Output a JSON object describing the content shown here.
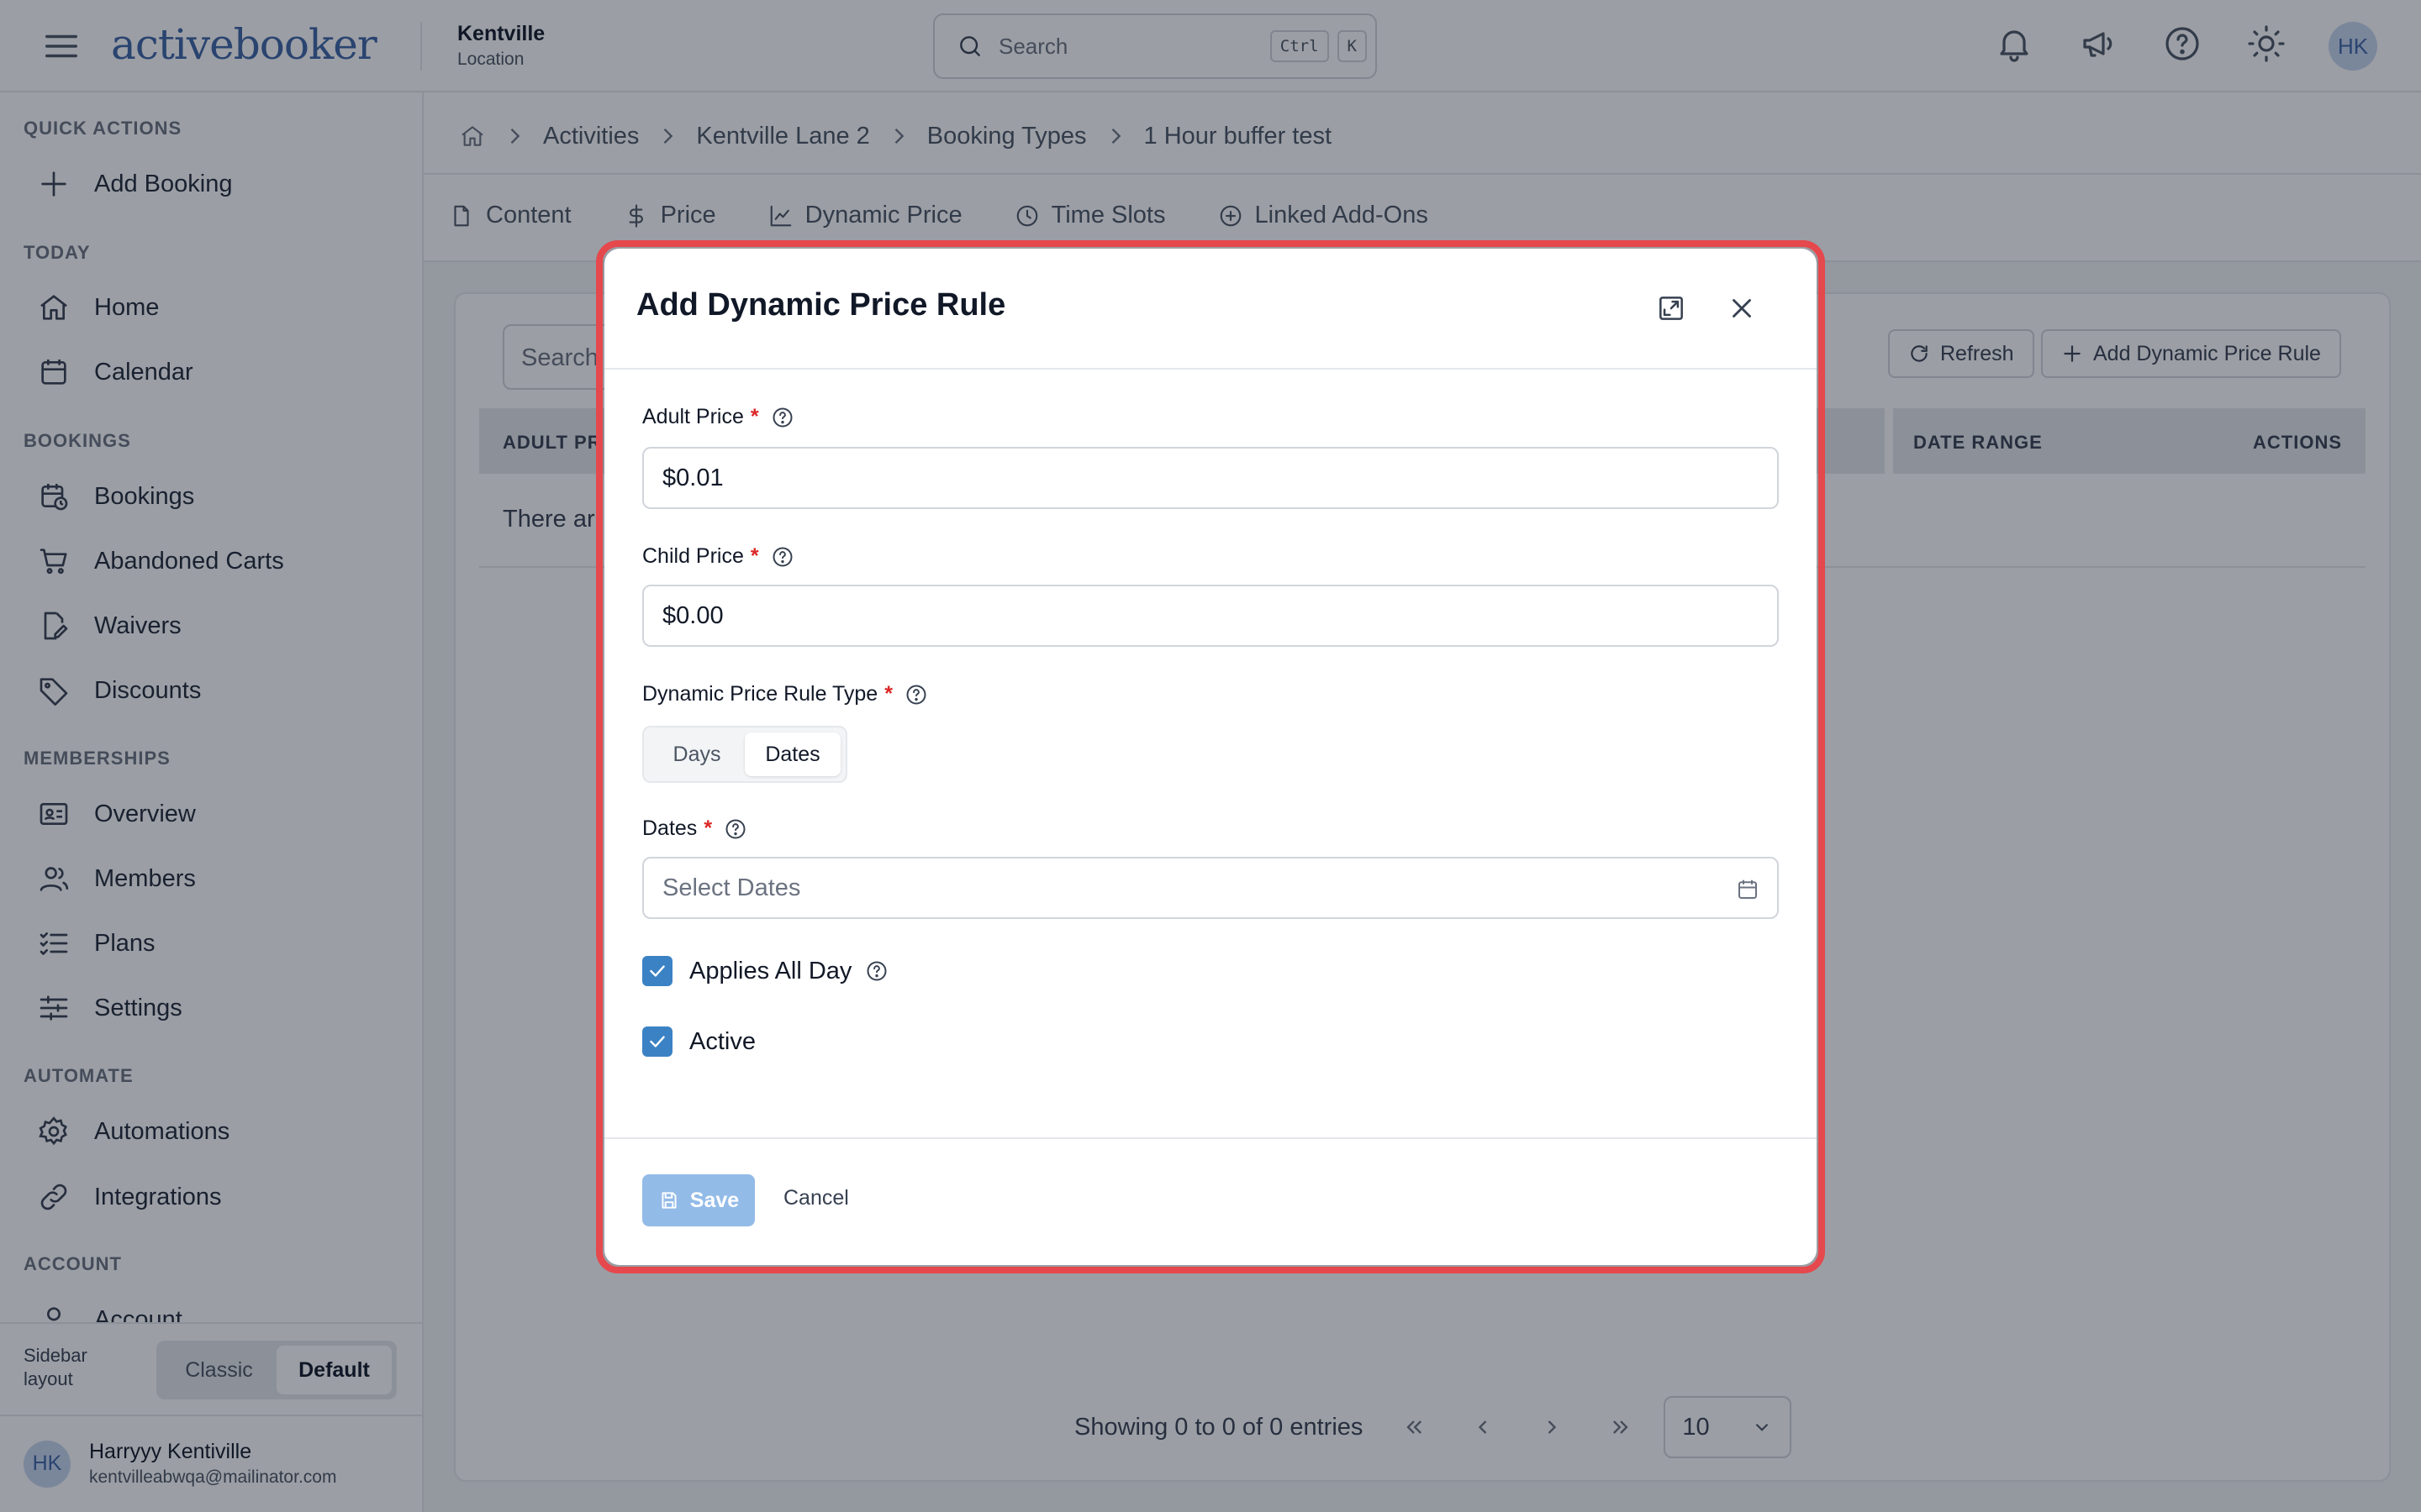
{
  "topbar": {
    "logo_prefix": "a",
    "logo_text": "ctivebooker",
    "location_name": "Kentville",
    "location_sub": "Location",
    "search_placeholder": "Search",
    "kbd_ctrl": "Ctrl",
    "kbd_k": "K",
    "avatar": "HK"
  },
  "sidebar": {
    "sections": {
      "quick_actions": "QUICK ACTIONS",
      "today": "TODAY",
      "bookings": "BOOKINGS",
      "memberships": "MEMBERSHIPS",
      "automate": "AUTOMATE",
      "account": "ACCOUNT"
    },
    "items": {
      "add_booking": "Add Booking",
      "home": "Home",
      "calendar": "Calendar",
      "bookings": "Bookings",
      "abandoned_carts": "Abandoned Carts",
      "waivers": "Waivers",
      "discounts": "Discounts",
      "overview": "Overview",
      "members": "Members",
      "plans": "Plans",
      "settings": "Settings",
      "automations": "Automations",
      "integrations": "Integrations",
      "account": "Account"
    },
    "layout_label": "Sidebar layout",
    "layout_classic": "Classic",
    "layout_default": "Default",
    "user_avatar": "HK",
    "user_name": "Harryyy Kentiville",
    "user_email": "kentvilleabwqa@mailinator.com"
  },
  "breadcrumb": {
    "activities": "Activities",
    "lane": "Kentville Lane 2",
    "booking_types": "Booking Types",
    "current": "1 Hour buffer test"
  },
  "tabs": {
    "content": "Content",
    "price": "Price",
    "dynamic_price": "Dynamic Price",
    "time_slots": "Time Slots",
    "linked_addons": "Linked Add-Ons"
  },
  "list": {
    "search_placeholder": "Search",
    "refresh": "Refresh",
    "add_rule": "Add Dynamic Price Rule",
    "col_adult_price": "ADULT PR",
    "col_date_range": "DATE RANGE",
    "col_actions": "ACTIONS",
    "empty": "There ar",
    "showing": "Showing 0 to 0 of 0 entries",
    "page_size": "10"
  },
  "modal": {
    "title": "Add Dynamic Price Rule",
    "adult_price_label": "Adult Price",
    "adult_price_value": "$0.01",
    "child_price_label": "Child Price",
    "child_price_value": "$0.00",
    "rule_type_label": "Dynamic Price Rule Type",
    "rule_type_days": "Days",
    "rule_type_dates": "Dates",
    "dates_label": "Dates",
    "dates_placeholder": "Select Dates",
    "applies_all_day": "Applies All Day",
    "active": "Active",
    "required_mark": "*",
    "save": "Save",
    "cancel": "Cancel"
  },
  "colors": {
    "brand": "#3d64a6",
    "highlight": "#e5484d",
    "checkbox": "#3b82c4",
    "save_disabled": "#93bbe8"
  }
}
